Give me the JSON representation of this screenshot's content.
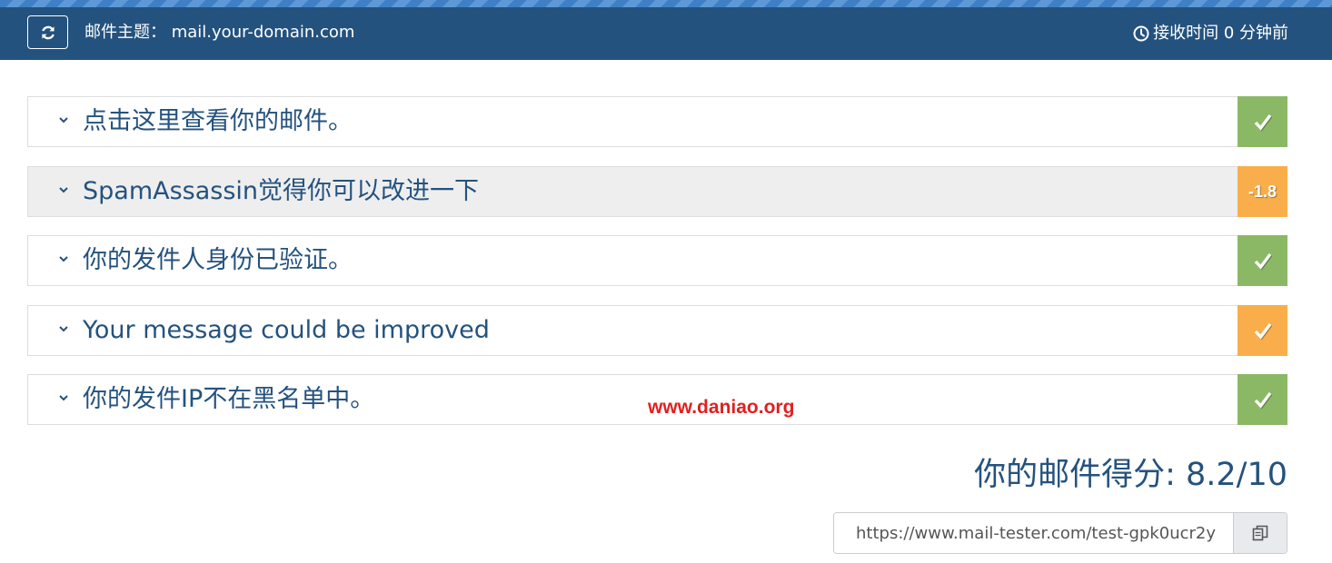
{
  "header": {
    "refresh_icon": "refresh-icon",
    "subject_label": "邮件主题：",
    "subject_value": "mail.your-domain.com",
    "received_icon": "clock-icon",
    "received_text": "接收时间 0 分钟前"
  },
  "panels": [
    {
      "title": "点击这里查看你的邮件。",
      "status": "check",
      "badge_color": "#8bb865"
    },
    {
      "title": "SpamAssassin觉得你可以改进一下",
      "status": "score",
      "score": "-1.8",
      "badge_color": "#f9ae4b"
    },
    {
      "title": "你的发件人身份已验证。",
      "status": "check",
      "badge_color": "#8bb865"
    },
    {
      "title": "Your message could be improved",
      "status": "check",
      "badge_color": "#f9ae4b"
    },
    {
      "title": "你的发件IP不在黑名单中。",
      "status": "check",
      "badge_color": "#8bb865"
    }
  ],
  "watermark": "www.daniao.org",
  "score_text": "你的邮件得分: 8.2/10",
  "share": {
    "url": "https://www.mail-tester.com/test-gpk0ucr2y",
    "copy_icon": "copy-icon"
  },
  "colors": {
    "header_bg": "#24527e",
    "title_text": "#24527e",
    "success": "#8bb865",
    "warning": "#f9ae4b"
  }
}
